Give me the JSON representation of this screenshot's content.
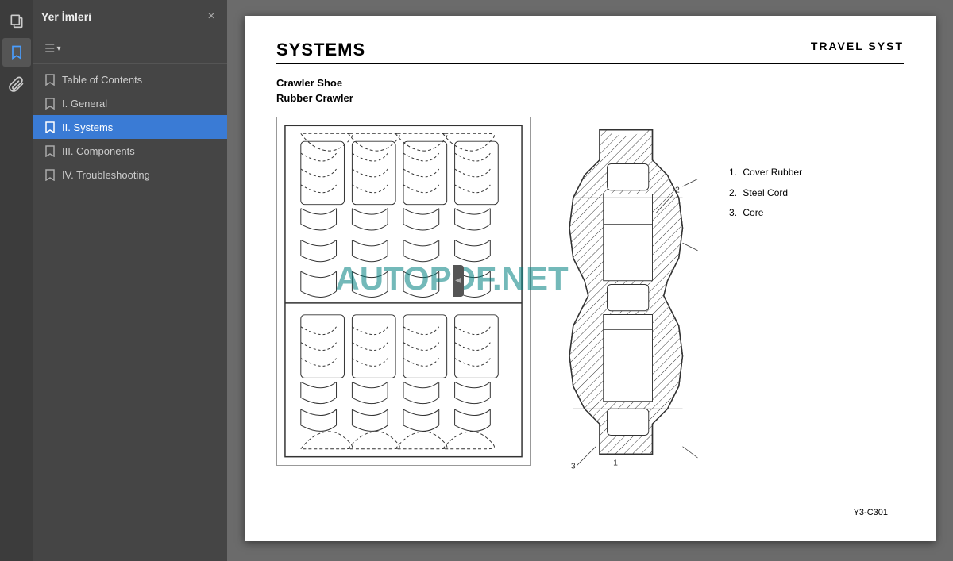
{
  "app": {
    "title": "Yer İmleri"
  },
  "sidebar": {
    "title": "Yer İmleri",
    "close_label": "×",
    "tool_icon": "≡",
    "tool_dropdown": "▾",
    "items": [
      {
        "id": "toc",
        "label": "Table of Contents",
        "active": false
      },
      {
        "id": "general",
        "label": "I. General",
        "active": false
      },
      {
        "id": "systems",
        "label": "II. Systems",
        "active": true
      },
      {
        "id": "components",
        "label": "III. Components",
        "active": false
      },
      {
        "id": "troubleshooting",
        "label": "IV. Troubleshooting",
        "active": false
      }
    ]
  },
  "collapse": {
    "icon": "◀"
  },
  "toolbar_icons": {
    "copy_icon": "⧉",
    "bookmark_icon": "🔖",
    "attachment_icon": "📎"
  },
  "page": {
    "title": "SYSTEMS",
    "section_title": "TRAVEL SYST",
    "subtitle1": "Crawler Shoe",
    "subtitle2": "Rubber Crawler",
    "watermark": "AUTOPDF.NET",
    "legend": [
      {
        "number": "1.",
        "label": "Cover Rubber"
      },
      {
        "number": "2.",
        "label": "Steel Cord"
      },
      {
        "number": "3.",
        "label": "Core"
      }
    ],
    "figure_caption": "Y3-C301"
  }
}
